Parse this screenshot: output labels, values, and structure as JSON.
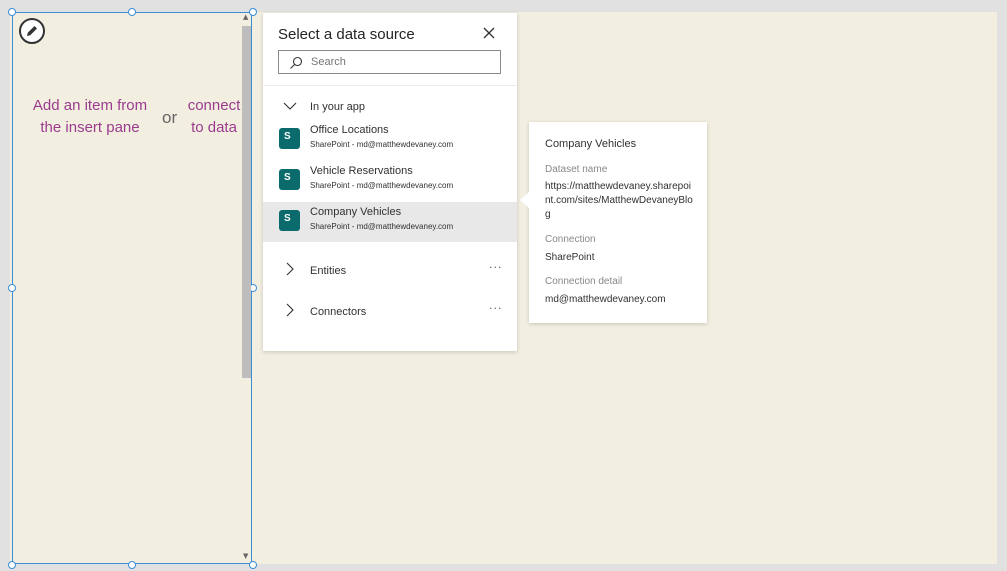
{
  "canvas": {
    "hint_left_line1": "Add an item from",
    "hint_left_line2": "the insert pane",
    "hint_or": "or",
    "hint_right_line1": "connect",
    "hint_right_line2": "to data"
  },
  "panel": {
    "title": "Select a data source",
    "search_placeholder": "Search",
    "in_your_app_label": "In your app",
    "items": [
      {
        "name": "Office Locations",
        "sub": "SharePoint - md@matthewdevaney.com",
        "icon_letter": "S"
      },
      {
        "name": "Vehicle Reservations",
        "sub": "SharePoint - md@matthewdevaney.com",
        "icon_letter": "S"
      },
      {
        "name": "Company Vehicles",
        "sub": "SharePoint - md@matthewdevaney.com",
        "icon_letter": "S"
      }
    ],
    "entities_label": "Entities",
    "connectors_label": "Connectors",
    "more_label": "···"
  },
  "details": {
    "title": "Company Vehicles",
    "dataset_label": "Dataset name",
    "dataset_value": "https://matthewdevaney.sharepoint.com/sites/MatthewDevaneyBlog",
    "connection_label": "Connection",
    "connection_value": "SharePoint",
    "detail_label": "Connection detail",
    "detail_value": "md@matthewdevaney.com"
  }
}
